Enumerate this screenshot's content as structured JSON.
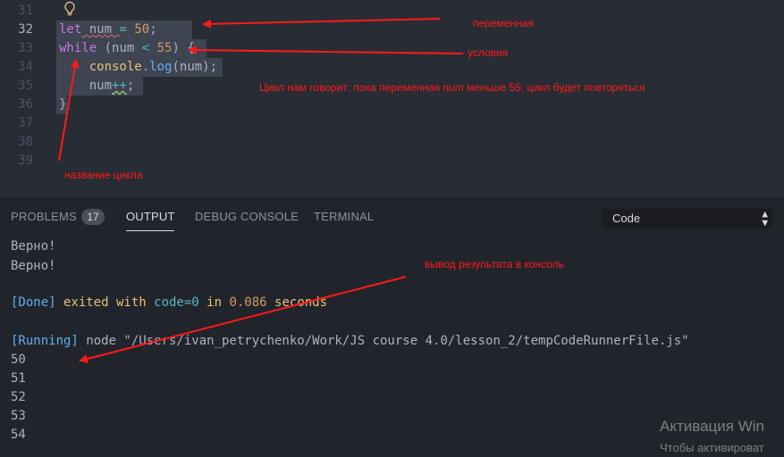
{
  "editor": {
    "line_numbers": [
      "31",
      "32",
      "33",
      "34",
      "35",
      "36",
      "37",
      "38",
      "39"
    ],
    "active_line": "32",
    "code": {
      "l32": {
        "kw": "let",
        "var": " num ",
        "op": "=",
        "sp": " ",
        "num": "50",
        "end": ";"
      },
      "l33": {
        "kw": "while",
        "p1": " (num ",
        "op": "<",
        "sp": " ",
        "num": "55",
        "p2": ") {"
      },
      "l34": {
        "indent": "    ",
        "obj": "console",
        "dot": ".",
        "fn": "log",
        "args": "(num);"
      },
      "l35": {
        "indent": "    ",
        "var": "num",
        "op": "++",
        "end": ";"
      },
      "l36": "}"
    }
  },
  "annotations": {
    "variable": "переменная",
    "condition": "условия",
    "explanation": "Цикл нам говорит: пока переменная num меньше 55, цикл будет повторяться",
    "loop_name": "название цикла",
    "console_output": "вывод результата в консоль"
  },
  "panel": {
    "tabs": [
      {
        "label": "PROBLEMS"
      },
      {
        "label": "OUTPUT"
      },
      {
        "label": "DEBUG CONSOLE"
      },
      {
        "label": "TERMINAL"
      }
    ],
    "problems_count": "17",
    "active_tab": "OUTPUT",
    "output_channel": "Code"
  },
  "output": {
    "line1": "Верно!",
    "line2": "Верно!",
    "done": {
      "tag": "[Done]",
      "text1": " exited with ",
      "code": "code=0",
      "text2": " in ",
      "time": "0.086",
      "text3": " seconds"
    },
    "running": {
      "tag": "[Running]",
      "text": " node \"/Users/ivan_petrychenko/Work/JS course 4.0/lesson_2/tempCodeRunnerFile.js\""
    },
    "numbers": [
      "50",
      "51",
      "52",
      "53",
      "54"
    ]
  },
  "watermark": {
    "title": "Активация Win",
    "subtitle": "Чтобы активироват"
  },
  "colors": {
    "annotation": "#ff1a1a",
    "background": "#282c34",
    "panel": "#21252b"
  }
}
